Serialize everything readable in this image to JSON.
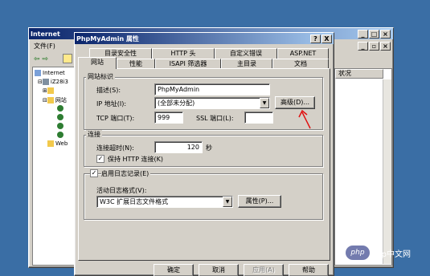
{
  "mmc": {
    "title": "Internet",
    "menu": [
      "文件(F)"
    ],
    "col_status": "状况",
    "tree": [
      "Internet",
      "iZ28i3",
      "网站",
      "Web"
    ]
  },
  "dialog": {
    "title": "PhpMyAdmin 属性",
    "help_btn": "?",
    "close_btn": "X",
    "tabs_row1": [
      "目录安全性",
      "HTTP 头",
      "自定义错误",
      "ASP.NET"
    ],
    "tabs_row2": [
      "网站",
      "性能",
      "ISAPI 筛选器",
      "主目录",
      "文档"
    ],
    "site_id_group": "网站标识",
    "desc_label": "描述(S):",
    "desc_value": "PhpMyAdmin",
    "ip_label": "IP 地址(I):",
    "ip_value": "(全部未分配)",
    "advanced_btn": "高级(D)...",
    "tcp_label": "TCP 端口(T):",
    "tcp_value": "999",
    "ssl_label": "SSL 端口(L):",
    "ssl_value": "",
    "conn_group": "连接",
    "timeout_label": "连接超时(N):",
    "timeout_value": "120",
    "timeout_unit": "秒",
    "keepalive_label": "保持 HTTP 连接(K)",
    "log_label": "启用日志记录(E)",
    "logformat_label": "活动日志格式(V):",
    "logformat_value": "W3C 扩展日志文件格式",
    "props_btn": "属性(P)...",
    "ok": "确定",
    "cancel": "取消",
    "apply": "应用(A)",
    "help": "帮助"
  },
  "watermark": "php中文网",
  "colors": {
    "desktop": "#3a6ea5",
    "title_start": "#0a246a",
    "title_end": "#a6caf0",
    "arrow": "#e01010"
  }
}
